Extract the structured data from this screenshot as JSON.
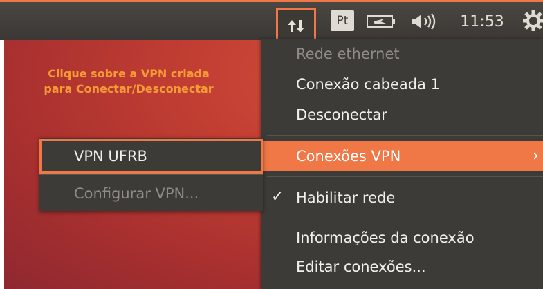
{
  "panel": {
    "keyboard_layout": "Pt",
    "clock": "11:53",
    "icons": [
      "network-updown-icon",
      "battery-icon",
      "volume-icon",
      "session-gear-icon"
    ]
  },
  "hint": {
    "line1": "Clique sobre a VPN criada",
    "line2": "para Conectar/Desconectar"
  },
  "menu": {
    "items": [
      {
        "label": "Rede ethernet"
      },
      {
        "label": "Conexão cabeada 1"
      },
      {
        "label": "Desconectar"
      },
      {
        "label": "Conexões VPN"
      },
      {
        "label": "Habilitar rede"
      },
      {
        "label": "Informações da conexão"
      },
      {
        "label": "Editar conexões..."
      }
    ],
    "check_glyph": "✓",
    "submenu_arrow": "›"
  },
  "vpn_submenu": {
    "items": [
      {
        "label": "VPN UFRB"
      },
      {
        "label": "Configurar VPN..."
      }
    ]
  },
  "colors": {
    "accent": "#f07746",
    "panel": "#3b3835",
    "menu_bg": "#3c3b37",
    "hint_text": "#f59a35",
    "wallpaper": "#c23e33"
  }
}
